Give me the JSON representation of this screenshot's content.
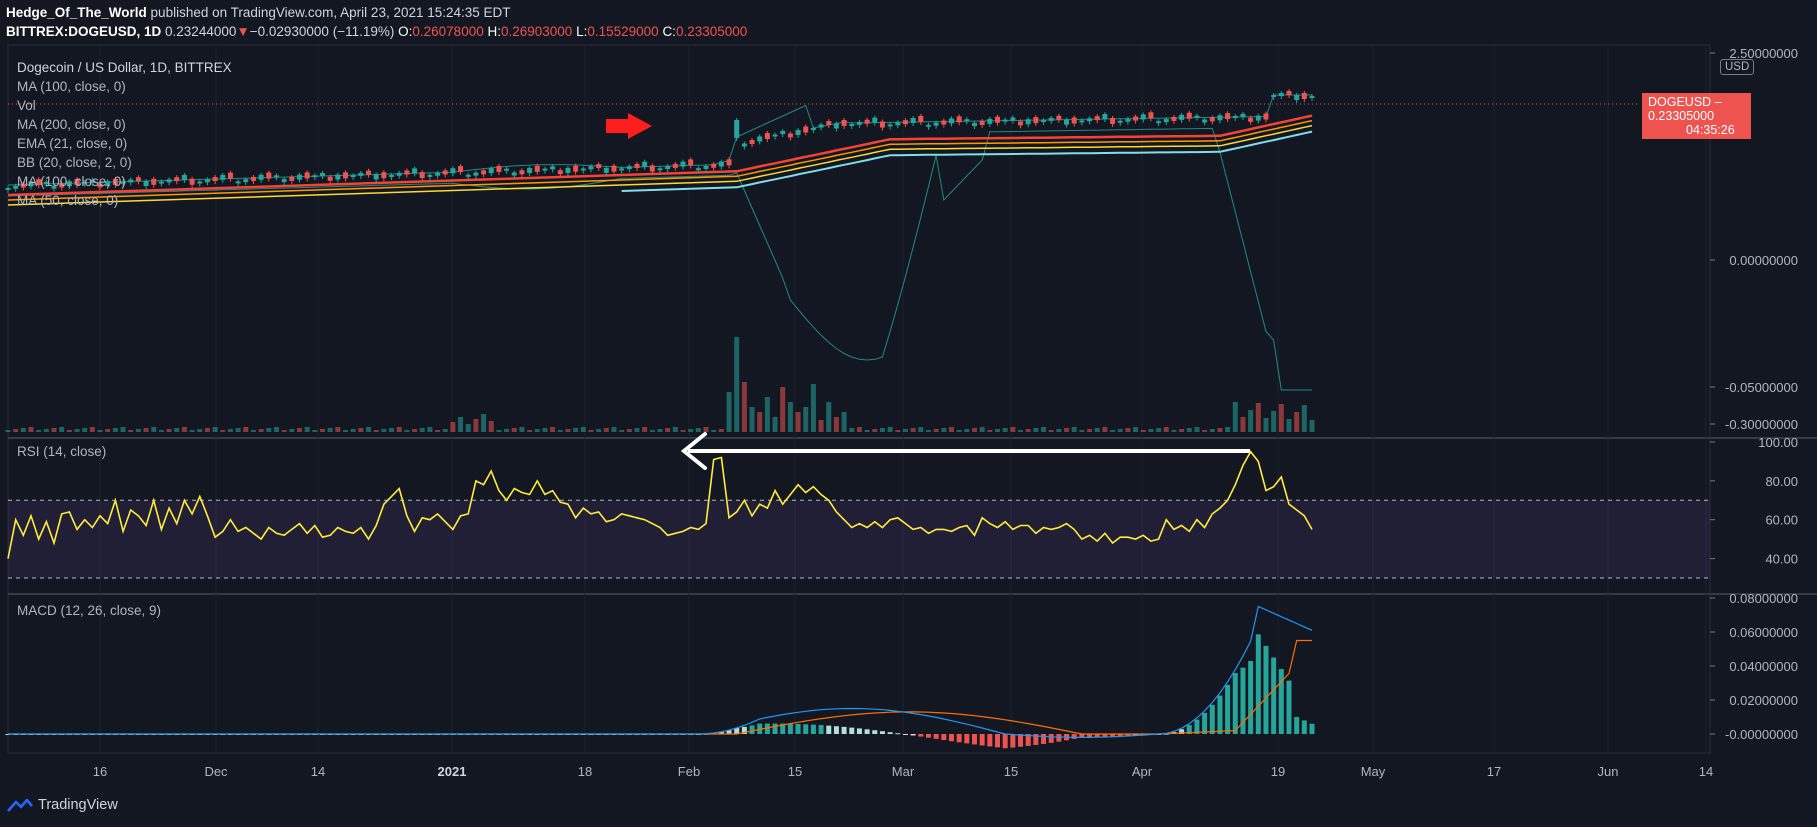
{
  "header": {
    "author": "Hedge_Of_The_World",
    "published": "published on TradingView.com, April 23, 2021 15:24:35 EDT",
    "symbol": "BITTREX:DOGEUSD, 1D",
    "last": "0.23244000",
    "change": "−0.02930000 (−11.19%)",
    "open_label": "O:",
    "open": "0.26078000",
    "high_label": "H:",
    "high": "0.26903000",
    "low_label": "L:",
    "low": "0.15529000",
    "close_label": "C:",
    "close": "0.23305000"
  },
  "legend": {
    "title": "Dogecoin / US Dollar, 1D, BITTREX",
    "items": [
      "MA (100, close, 0)",
      "Vol",
      "MA (200, close, 0)",
      "EMA (21, close, 0)",
      "BB (20, close, 2, 0)",
      "MA (100, close, 0)",
      "MA (50, close, 0)"
    ]
  },
  "price_tag": {
    "symbol": "DOGEUSD",
    "price": "0.23305000",
    "countdown": "04:35:26"
  },
  "currency": "USD",
  "rsi_label": "RSI (14, close)",
  "macd_label": "MACD (12, 26, close, 9)",
  "brand": "TradingView",
  "colors": {
    "background": "#131722",
    "up": "#26a69a",
    "down": "#ef5350",
    "ma_red": "#f44336",
    "ma_orange": "#ff9800",
    "ma_yellow": "#fdd835",
    "ma_cyan": "#80deea",
    "bb": "#26a69a",
    "rsi": "#ffeb3b",
    "rsi_band": "#7e57c2",
    "macd": "#2196f3",
    "signal": "#ff6d00",
    "arrow_red": "#ff1e1e",
    "arrow_white": "#ffffff"
  },
  "chart_data": [
    {
      "type": "candlestick",
      "title": "Dogecoin / US Dollar, 1D, BITTREX",
      "y_tick_labels": [
        "2.50000000",
        "0.00000000",
        "-0.05000000",
        "-0.30000000"
      ],
      "x_tick_labels": [
        "16",
        "Dec",
        "14",
        "2021",
        "18",
        "Feb",
        "15",
        "Mar",
        "15",
        "Apr",
        "19",
        "May",
        "17",
        "Jun",
        "14"
      ],
      "last_price": 0.23305
    },
    {
      "type": "line",
      "title": "RSI (14, close)",
      "y_tick_labels": [
        "100.00",
        "80.00",
        "60.00",
        "40.00"
      ],
      "upper_band": 70,
      "lower_band": 30,
      "values": [
        40,
        60,
        52,
        62,
        50,
        59,
        48,
        63,
        64,
        55,
        60,
        56,
        62,
        58,
        70,
        54,
        65,
        62,
        57,
        70,
        55,
        66,
        58,
        70,
        63,
        72,
        62,
        51,
        54,
        60,
        54,
        56,
        53,
        50,
        56,
        53,
        52,
        55,
        58,
        53,
        57,
        51,
        52,
        56,
        54,
        53,
        56,
        50,
        57,
        68,
        72,
        76,
        62,
        54,
        61,
        60,
        63,
        59,
        55,
        62,
        63,
        80,
        78,
        85,
        75,
        70,
        76,
        74,
        73,
        80,
        73,
        75,
        69,
        68,
        61,
        66,
        63,
        64,
        59,
        60,
        63,
        62,
        61,
        60,
        58,
        56,
        52,
        53,
        54,
        56,
        55,
        58,
        91,
        92,
        61,
        64,
        70,
        62,
        68,
        66,
        75,
        68,
        73,
        78,
        74,
        77,
        73,
        70,
        64,
        60,
        56,
        58,
        56,
        59,
        56,
        60,
        61,
        58,
        55,
        56,
        53,
        55,
        55,
        54,
        56,
        57,
        52,
        61,
        58,
        56,
        59,
        55,
        57,
        57,
        53,
        56,
        55,
        56,
        58,
        55,
        50,
        52,
        49,
        53,
        48,
        51,
        51,
        50,
        52,
        49,
        50,
        60,
        55,
        57,
        54,
        60,
        56,
        63,
        66,
        70,
        78,
        88,
        95,
        90,
        75,
        77,
        82,
        68,
        65,
        62,
        55
      ]
    },
    {
      "type": "bar",
      "title": "MACD (12, 26, close, 9)",
      "y_tick_labels": [
        "0.08000000",
        "0.06000000",
        "0.04000000",
        "0.02000000",
        "-0.00000000"
      ]
    }
  ]
}
